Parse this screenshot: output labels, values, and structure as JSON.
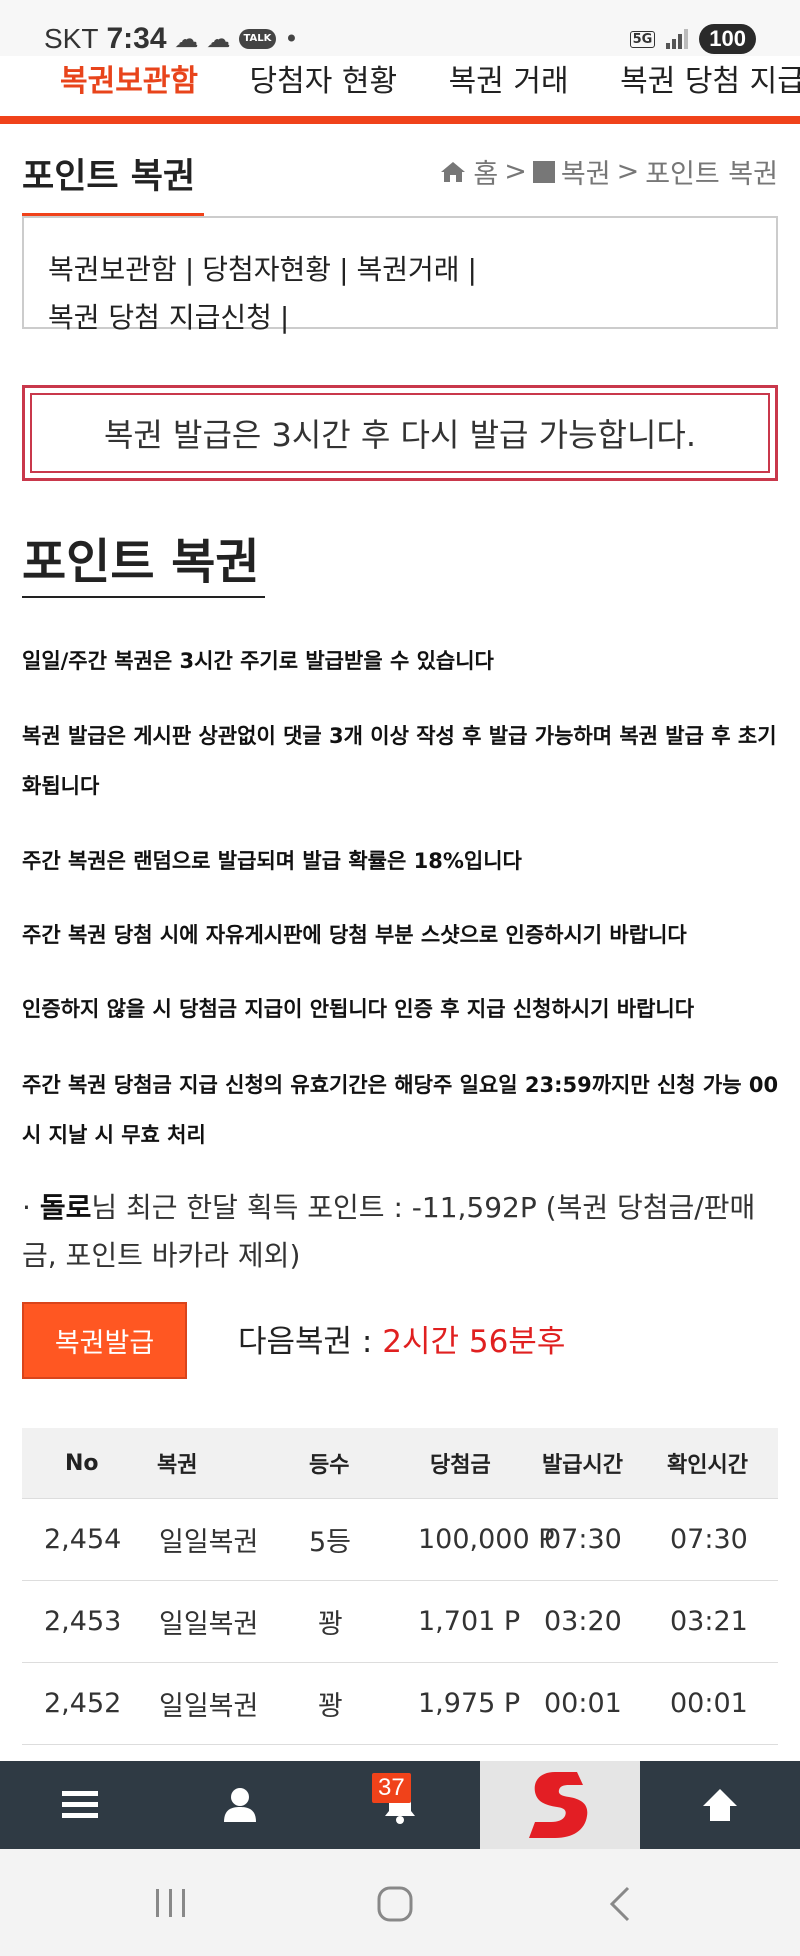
{
  "status_bar": {
    "carrier": "SKT",
    "time": "7:34",
    "talk_badge": "TALK",
    "network": "5G",
    "battery": "100"
  },
  "top_nav": {
    "items": [
      {
        "label": "복권보관함",
        "active": true
      },
      {
        "label": "당첨자 현황",
        "active": false
      },
      {
        "label": "복권 거래",
        "active": false
      },
      {
        "label": "복권 당첨 지급",
        "active": false
      }
    ]
  },
  "page": {
    "title": "포인트 복권",
    "breadcrumb": {
      "home": "홈",
      "sep1": ">",
      "section": "복권",
      "sep2": ">",
      "current": "포인트 복권"
    }
  },
  "sub_menu": {
    "items": [
      "복권보관함",
      "당첨자현황",
      "복권거래",
      "복권 당첨 지급신청"
    ],
    "separator": "|"
  },
  "notice": "복권 발급은 3시간 후 다시 발급 가능합니다.",
  "section_title": "포인트 복권",
  "rules": [
    "일일/주간 복권은 3시간 주기로 발급받을 수 있습니다",
    "복권 발급은 게시판 상관없이 댓글 3개 이상 작성 후 발급 가능하며 복권 발급 후 초기화됩니다",
    "주간 복권은 랜덤으로 발급되며 발급 확률은 18%입니다",
    "주간 복권 당첨 시에 자유게시판에 당첨 부분 스샷으로 인증하시기 바랍니다",
    "인증하지 않을 시 당첨금 지급이 안됩니다 인증 후 지급 신청하시기 바랍니다",
    "주간 복권 당첨금 지급 신청의 유효기간은 해당주 일요일 23:59까지만 신청 가능 00시 지날 시 무효 처리"
  ],
  "points": {
    "bullet": "·",
    "user": "돌로",
    "text": "님 최근 한달 획득 포인트 : -11,592P (복권 당첨금/판매금, 포인트 바카라 제외)"
  },
  "issue": {
    "button_label": "복권발급",
    "next_label": "다음복권 : ",
    "next_value": "2시간 56분후"
  },
  "table": {
    "headers": [
      "No",
      "복권",
      "등수",
      "당첨금",
      "발급시간",
      "확인시간"
    ],
    "rows": [
      [
        "2,454",
        "일일복권",
        "5등",
        "100,000 P",
        "07:30",
        "07:30"
      ],
      [
        "2,453",
        "일일복권",
        "꽝",
        "1,701 P",
        "03:20",
        "03:21"
      ],
      [
        "2,452",
        "일일복권",
        "꽝",
        "1,975 P",
        "00:01",
        "00:01"
      ]
    ]
  },
  "bottom_bar": {
    "notification_count": "37"
  },
  "colors": {
    "accent": "#f0421a",
    "notice_border": "#c9384b",
    "next_time": "#e02020",
    "toolbar": "#2f3a44"
  }
}
